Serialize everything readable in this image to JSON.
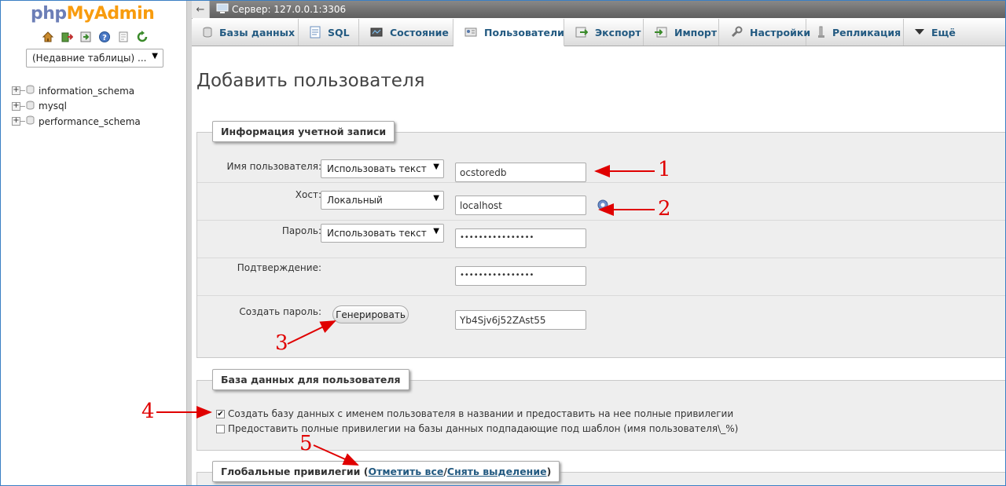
{
  "nav": {
    "logo_php": "php",
    "logo_myadmin": "MyAdmin",
    "icons": [
      "home-icon",
      "exit-icon",
      "sql-query-icon",
      "help-icon",
      "docs-icon",
      "reload-icon"
    ],
    "recent_tables": "(Недавние таблицы) ...",
    "databases": [
      "information_schema",
      "mysql",
      "performance_schema"
    ]
  },
  "topbar": {
    "server": "Сервер: 127.0.0.1:3306"
  },
  "tabs": [
    {
      "label": "Базы данных",
      "icon": "database-icon"
    },
    {
      "label": "SQL",
      "icon": "sql-icon"
    },
    {
      "label": "Состояние",
      "icon": "status-icon"
    },
    {
      "label": "Пользователи",
      "icon": "users-icon",
      "active": true
    },
    {
      "label": "Экспорт",
      "icon": "export-icon"
    },
    {
      "label": "Импорт",
      "icon": "import-icon"
    },
    {
      "label": "Настройки",
      "icon": "wrench-icon"
    },
    {
      "label": "Репликация",
      "icon": "replication-icon"
    },
    {
      "label": "Ещё",
      "icon": "chevron-down-icon"
    }
  ],
  "page": {
    "title": "Добавить пользователя"
  },
  "account": {
    "legend": "Информация учетной записи",
    "username_label": "Имя пользователя:",
    "username_type": "Использовать текст",
    "username_value": "ocstoredb",
    "host_label": "Хост:",
    "host_type": "Локальный",
    "host_value": "localhost",
    "password_label": "Пароль:",
    "password_type": "Использовать текст",
    "password_value": "••••••••••••••••",
    "confirm_label": "Подтверждение:",
    "confirm_value": "••••••••••••••••",
    "generate_label": "Создать пароль:",
    "generate_button": "Генерировать",
    "generated_value": "Yb4Sjv6j52ZAst55"
  },
  "database": {
    "legend": "База данных для пользователя",
    "option1": "Создать базу данных с именем пользователя в названии и предоставить на нее полные привилегии",
    "option1_checked": true,
    "option2": "Предоставить полные привилегии на базы данных подпадающие под шаблон (имя пользователя\\_%)",
    "option2_checked": false
  },
  "global": {
    "legend_prefix": "Глобальные привилегии (",
    "check_all": "Отметить все",
    "uncheck_sep": " /",
    "uncheck_all": "Снять выделение",
    "legend_suffix": ")"
  },
  "annotations": {
    "n1": "1",
    "n2": "2",
    "n3": "3",
    "n4": "4",
    "n5": "5",
    "color": "#e00000"
  },
  "colors": {
    "link": "#235a81",
    "logo_php": "#6c7eb7",
    "logo_myadmin": "#f89c0e",
    "server_bar": "#707070"
  }
}
